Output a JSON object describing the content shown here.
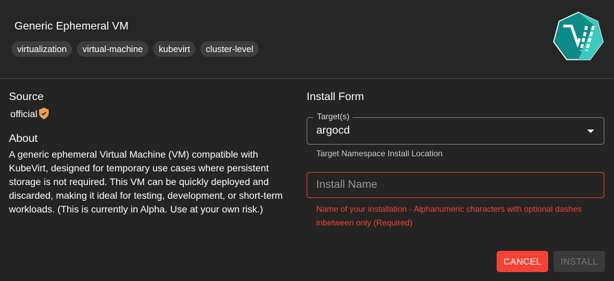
{
  "header": {
    "title": "Generic Ephemeral VM",
    "tags": [
      "virtualization",
      "virtual-machine",
      "kubevirt",
      "cluster-level"
    ]
  },
  "source": {
    "heading": "Source",
    "value": "official"
  },
  "about": {
    "heading": "About",
    "text": "A generic ephemeral Virtual Machine (VM) compatible with KubeVirt, designed for temporary use cases where persistent storage is not required. This VM can be quickly deployed and discarded, making it ideal for testing, development, or short-term workloads. (This is currently in Alpha. Use at your own risk.)"
  },
  "form": {
    "heading": "Install Form",
    "target_label": "Target(s)",
    "target_value": "argocd",
    "target_help": "Target Namespace Install Location",
    "name_placeholder": "Install Name",
    "name_error": "Name of your installation - Alphanumeric characters with optional dashes inbetween only (Required)",
    "cancel": "CANCEL",
    "install": "INSTALL"
  },
  "colors": {
    "accent": "#f44336",
    "badge": "#f0a050",
    "logo": "#159e9c"
  }
}
